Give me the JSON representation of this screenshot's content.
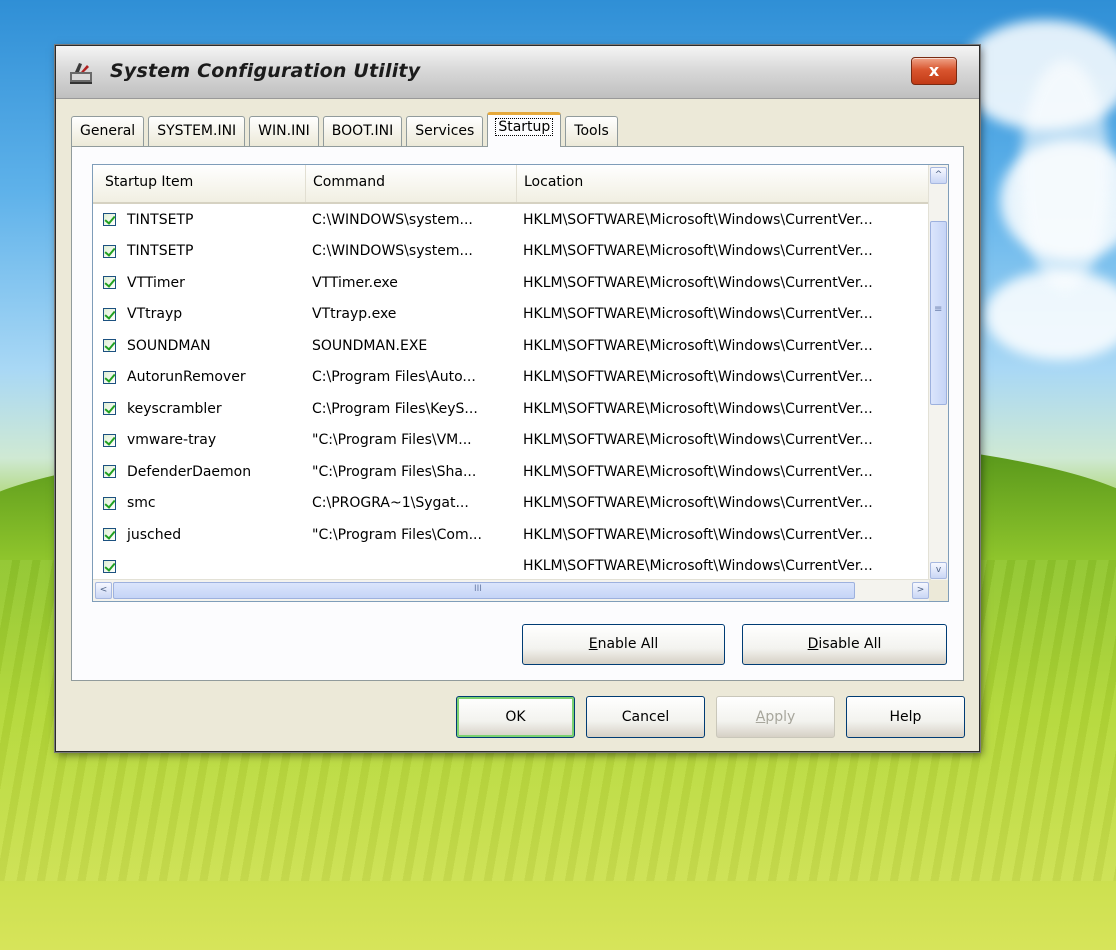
{
  "window": {
    "title": "System Configuration Utility",
    "close_label": "x"
  },
  "tabs": [
    {
      "label": "General",
      "active": false
    },
    {
      "label": "SYSTEM.INI",
      "active": false
    },
    {
      "label": "WIN.INI",
      "active": false
    },
    {
      "label": "BOOT.INI",
      "active": false
    },
    {
      "label": "Services",
      "active": false
    },
    {
      "label": "Startup",
      "active": true
    },
    {
      "label": "Tools",
      "active": false
    }
  ],
  "list": {
    "columns": [
      "Startup Item",
      "Command",
      "Location"
    ],
    "rows": [
      {
        "item": "TINTSETP",
        "command": "C:\\WINDOWS\\system...",
        "location": "HKLM\\SOFTWARE\\Microsoft\\Windows\\CurrentVer...",
        "checked": true
      },
      {
        "item": "TINTSETP",
        "command": "C:\\WINDOWS\\system...",
        "location": "HKLM\\SOFTWARE\\Microsoft\\Windows\\CurrentVer...",
        "checked": true
      },
      {
        "item": "VTTimer",
        "command": "VTTimer.exe",
        "location": "HKLM\\SOFTWARE\\Microsoft\\Windows\\CurrentVer...",
        "checked": true
      },
      {
        "item": "VTtrayp",
        "command": "VTtrayp.exe",
        "location": "HKLM\\SOFTWARE\\Microsoft\\Windows\\CurrentVer...",
        "checked": true
      },
      {
        "item": "SOUNDMAN",
        "command": "SOUNDMAN.EXE",
        "location": "HKLM\\SOFTWARE\\Microsoft\\Windows\\CurrentVer...",
        "checked": true
      },
      {
        "item": "AutorunRemover",
        "command": "C:\\Program Files\\Auto...",
        "location": "HKLM\\SOFTWARE\\Microsoft\\Windows\\CurrentVer...",
        "checked": true
      },
      {
        "item": "keyscrambler",
        "command": "C:\\Program Files\\KeyS...",
        "location": "HKLM\\SOFTWARE\\Microsoft\\Windows\\CurrentVer...",
        "checked": true
      },
      {
        "item": "vmware-tray",
        "command": "\"C:\\Program Files\\VM...",
        "location": "HKLM\\SOFTWARE\\Microsoft\\Windows\\CurrentVer...",
        "checked": true
      },
      {
        "item": "DefenderDaemon",
        "command": "\"C:\\Program Files\\Sha...",
        "location": "HKLM\\SOFTWARE\\Microsoft\\Windows\\CurrentVer...",
        "checked": true
      },
      {
        "item": "smc",
        "command": "C:\\PROGRA~1\\Sygat...",
        "location": "HKLM\\SOFTWARE\\Microsoft\\Windows\\CurrentVer...",
        "checked": true
      },
      {
        "item": "jusched",
        "command": "\"C:\\Program Files\\Com...",
        "location": "HKLM\\SOFTWARE\\Microsoft\\Windows\\CurrentVer...",
        "checked": true
      },
      {
        "item": "",
        "command": "",
        "location": "HKLM\\SOFTWARE\\Microsoft\\Windows\\CurrentVer...",
        "checked": true
      }
    ]
  },
  "scrollbar": {
    "up_glyph": "^",
    "grip_glyph": "≡",
    "down_glyph": "v",
    "left_glyph": "<",
    "right_glyph": ">",
    "h_grip_glyph": "III"
  },
  "buttons": {
    "enable_all": {
      "prefix": "",
      "accel": "E",
      "rest": "nable All"
    },
    "disable_all": {
      "prefix": "",
      "accel": "D",
      "rest": "isable All"
    },
    "ok": "OK",
    "cancel": "Cancel",
    "apply": {
      "prefix": "",
      "accel": "A",
      "rest": "pply"
    },
    "help": "Help"
  },
  "icons": {
    "title": "msconfig-icon",
    "close": "close-icon"
  },
  "colors": {
    "active_tab_accent": "#e6a93b",
    "close_button": "#c23a16",
    "check_mark": "#21a121",
    "default_button_glow": "#7bd170"
  }
}
